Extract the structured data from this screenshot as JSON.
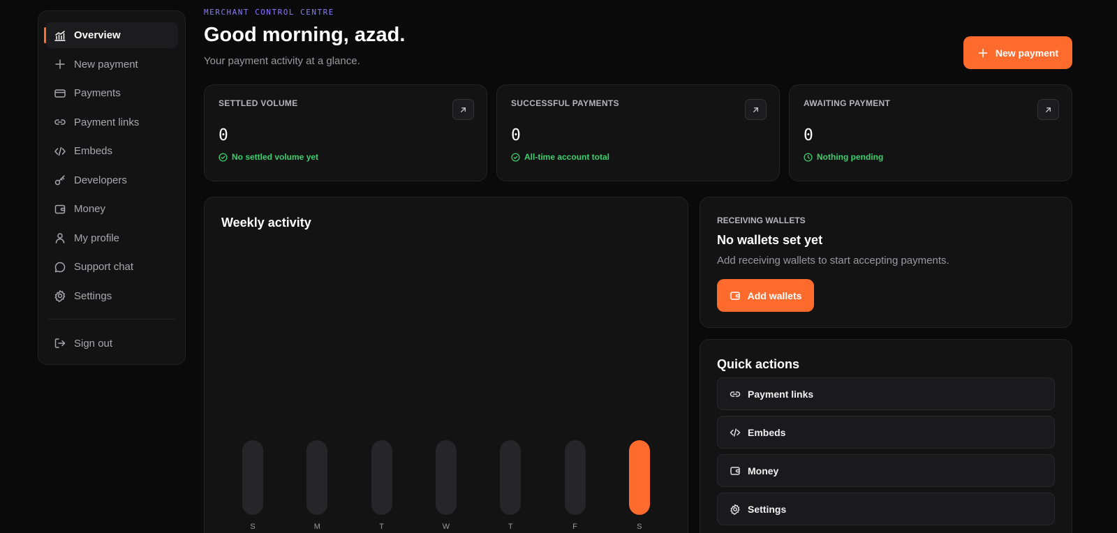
{
  "sidebar": {
    "items": [
      {
        "label": "Overview",
        "icon": "chart-icon",
        "active": true
      },
      {
        "label": "New payment",
        "icon": "plus-icon"
      },
      {
        "label": "Payments",
        "icon": "card-icon"
      },
      {
        "label": "Payment links",
        "icon": "link-icon"
      },
      {
        "label": "Embeds",
        "icon": "code-icon"
      },
      {
        "label": "Developers",
        "icon": "key-icon"
      },
      {
        "label": "Money",
        "icon": "wallet-icon"
      },
      {
        "label": "My profile",
        "icon": "user-icon"
      },
      {
        "label": "Support chat",
        "icon": "chat-icon"
      },
      {
        "label": "Settings",
        "icon": "gear-icon"
      }
    ],
    "sign_out": "Sign out"
  },
  "header": {
    "eyebrow": "MERCHANT CONTROL CENTRE",
    "greeting": "Good morning, azad.",
    "subtitle": "Your payment activity at a glance.",
    "new_payment": "New payment"
  },
  "stats": [
    {
      "label": "SETTLED VOLUME",
      "value": "0",
      "note": "No settled volume yet",
      "note_icon": "check-circle-icon"
    },
    {
      "label": "SUCCESSFUL PAYMENTS",
      "value": "0",
      "note": "All-time account total",
      "note_icon": "check-circle-icon"
    },
    {
      "label": "AWAITING PAYMENT",
      "value": "0",
      "note": "Nothing pending",
      "note_icon": "clock-icon"
    }
  ],
  "weekly": {
    "title": "Weekly activity",
    "days": [
      "S",
      "M",
      "T",
      "W",
      "T",
      "F",
      "S"
    ],
    "highlight_index": 6
  },
  "wallets": {
    "label": "RECEIVING WALLETS",
    "heading": "No wallets set yet",
    "desc": "Add receiving wallets to start accepting payments.",
    "button": "Add wallets"
  },
  "quick": {
    "title": "Quick actions",
    "items": [
      {
        "label": "Payment links",
        "icon": "link-icon"
      },
      {
        "label": "Embeds",
        "icon": "code-icon"
      },
      {
        "label": "Money",
        "icon": "wallet-icon"
      },
      {
        "label": "Settings",
        "icon": "gear-icon"
      }
    ]
  },
  "colors": {
    "accent": "#ff6b2c",
    "success": "#3ecf6e",
    "eyebrow": "#8a7cff",
    "background": "#0a0a0b",
    "card": "#131314"
  }
}
